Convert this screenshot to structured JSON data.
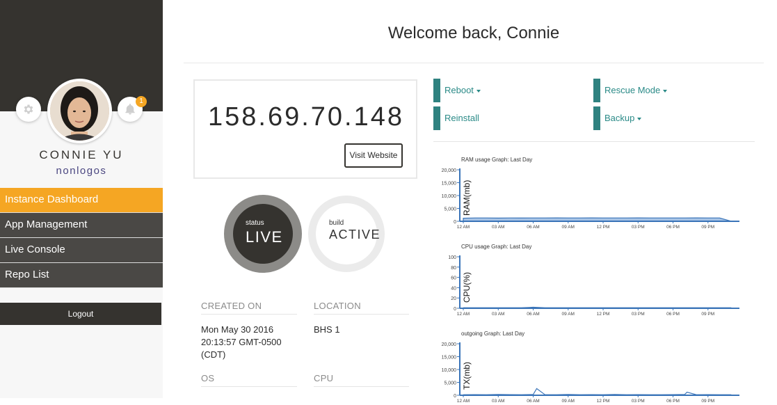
{
  "user": {
    "name": "CONNIE YU",
    "handle": "nonlogos",
    "notification_count": "1"
  },
  "nav": {
    "items": [
      {
        "label": "Instance Dashboard",
        "active": true
      },
      {
        "label": "App Management",
        "active": false
      },
      {
        "label": "Live Console",
        "active": false
      },
      {
        "label": "Repo List",
        "active": false
      }
    ],
    "logout_label": "Logout"
  },
  "header": {
    "welcome": "Welcome back, Connie"
  },
  "instance": {
    "ip": "158.69.70.148",
    "visit_label": "Visit Website",
    "status_label": "status",
    "status_value": "LIVE",
    "build_label": "build",
    "build_value": "ACTIVE",
    "created_on_label": "CREATED ON",
    "created_on_value": "Mon May 30 2016 20:13:57 GMT-0500 (CDT)",
    "location_label": "LOCATION",
    "location_value": "BHS 1",
    "os_label": "OS",
    "cpu_label": "CPU"
  },
  "actions": {
    "reboot": "Reboot",
    "rescue": "Rescue Mode",
    "reinstall": "Reinstall",
    "backup": "Backup"
  },
  "colors": {
    "accent": "#f5a623",
    "dark": "#35332f",
    "teal": "#2f8280",
    "chart_line": "#3a74b8"
  },
  "chart_data": [
    {
      "type": "area",
      "title": "RAM usage Graph: Last Day",
      "ylabel": "RAM(mb)",
      "ylim": [
        0,
        20000
      ],
      "yticks": [
        "20,000",
        "15,000",
        "10,000",
        "5,000",
        "0"
      ],
      "xticks": [
        "12 AM",
        "03 AM",
        "06 AM",
        "09 AM",
        "12 PM",
        "03 PM",
        "06 PM",
        "09 PM"
      ],
      "x": [
        0,
        1,
        2,
        3,
        4,
        5,
        6,
        7,
        8,
        9,
        10,
        11,
        12,
        13,
        14,
        15,
        16,
        17,
        18,
        19,
        20,
        21,
        22,
        23
      ],
      "values": [
        1200,
        1300,
        1300,
        1250,
        1300,
        1280,
        1300,
        1300,
        1320,
        1300,
        1300,
        1310,
        1300,
        1300,
        1300,
        1320,
        1300,
        1300,
        1300,
        1300,
        1310,
        1300,
        1300,
        0
      ]
    },
    {
      "type": "line",
      "title": "CPU usage Graph: Last Day",
      "ylabel": "CPU(%)",
      "ylim": [
        0,
        100
      ],
      "yticks": [
        "100",
        "80",
        "60",
        "40",
        "20",
        "0"
      ],
      "xticks": [
        "12 AM",
        "03 AM",
        "06 AM",
        "09 AM",
        "12 PM",
        "03 PM",
        "06 PM",
        "09 PM"
      ],
      "x": [
        0,
        1,
        2,
        3,
        4,
        5,
        6,
        7,
        8,
        9,
        10,
        11,
        12,
        13,
        14,
        15,
        16,
        17,
        18,
        19,
        20,
        21,
        22,
        23
      ],
      "values": [
        1,
        1,
        1,
        1,
        1,
        1,
        2,
        1,
        1,
        1,
        1,
        1,
        1,
        1,
        1,
        1,
        1,
        1,
        1,
        1,
        1,
        1,
        1,
        1
      ]
    },
    {
      "type": "line",
      "title": "outgoing Graph: Last Day",
      "ylabel": "TX(mb)",
      "ylim": [
        0,
        20000
      ],
      "yticks": [
        "20,000",
        "15,000",
        "10,000",
        "5,000",
        "0"
      ],
      "xticks": [
        "12 AM",
        "03 AM",
        "06 AM",
        "09 AM",
        "12 PM",
        "03 PM",
        "06 PM",
        "09 PM"
      ],
      "x": [
        0,
        1,
        2,
        3,
        4,
        5,
        6,
        6.3,
        7,
        8,
        9,
        10,
        11,
        12,
        13,
        14,
        15,
        16,
        17,
        18,
        19,
        19.2,
        20,
        21,
        22,
        23
      ],
      "values": [
        200,
        250,
        200,
        300,
        250,
        200,
        300,
        2600,
        250,
        200,
        300,
        200,
        250,
        200,
        300,
        200,
        250,
        200,
        200,
        250,
        300,
        1200,
        200,
        250,
        200,
        200
      ]
    }
  ]
}
